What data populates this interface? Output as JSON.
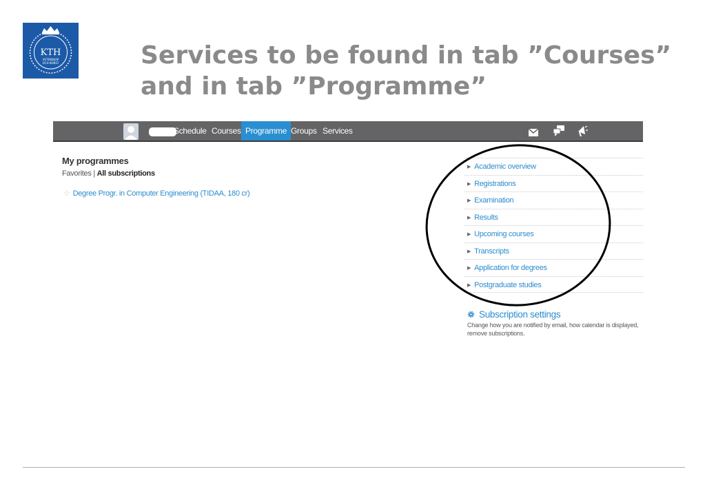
{
  "logo": {
    "text": "KTH",
    "subtext_1": "VETENSKAP",
    "subtext_2": "OCH KONST"
  },
  "slide": {
    "title_line1": "Services to be found in tab ”Courses”",
    "title_line2": "and in tab ”Programme”"
  },
  "nav": {
    "tabs": [
      {
        "label": "Schedule",
        "active": false
      },
      {
        "label": "Courses",
        "active": false
      },
      {
        "label": "Programme",
        "active": true
      },
      {
        "label": "Groups",
        "active": false
      },
      {
        "label": "Services",
        "active": false
      }
    ],
    "icons": [
      "mail-icon",
      "chat-icon",
      "megaphone-icon"
    ],
    "colors": {
      "bar": "#646466",
      "active": "#2a8fd0"
    }
  },
  "programmes": {
    "heading": "My programmes",
    "filter_favorites": "Favorites",
    "filter_separator": "|",
    "filter_all": "All subscriptions",
    "items": [
      "Degree Progr. in Computer Engineering (TIDAA, 180 cr)"
    ]
  },
  "menu": {
    "items": [
      "Academic overview",
      "Registrations",
      "Examination",
      "Results",
      "Upcoming courses",
      "Transcripts",
      "Application for degrees",
      "Postgraduate studies"
    ]
  },
  "settings": {
    "title": "Subscription settings",
    "description": "Change how you are notified by email, how calendar is displayed, remove subscriptions."
  },
  "colors": {
    "link": "#2b8ccd",
    "title_gray": "#8a8a8a",
    "logo_blue": "#1c5aa8"
  }
}
